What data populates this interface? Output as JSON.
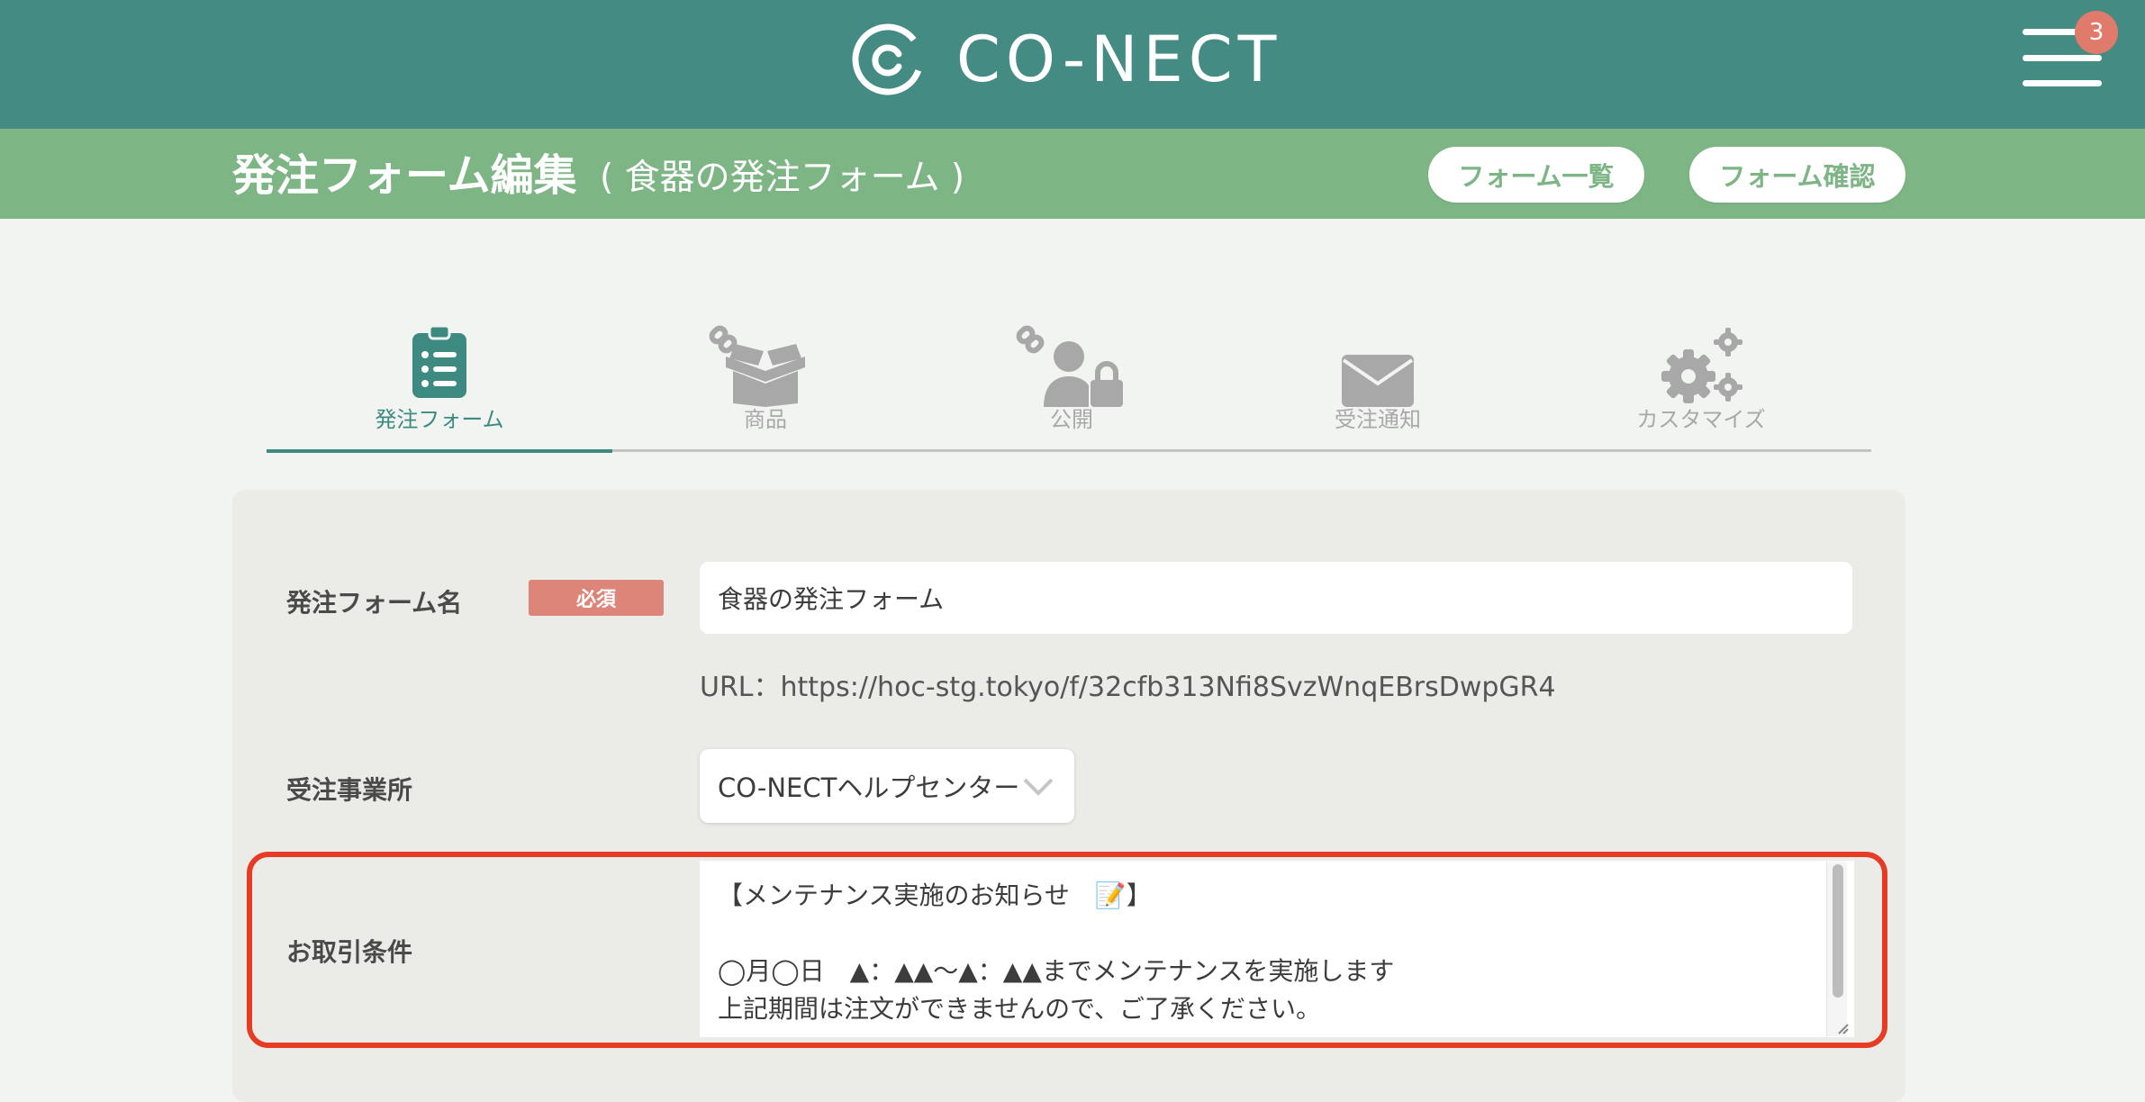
{
  "header": {
    "logo_text": "CO-NECT",
    "notification_count": "3"
  },
  "subheader": {
    "title": "発注フォーム編集",
    "subtitle": "( 食器の発注フォーム )",
    "form_list_button": "フォーム一覧",
    "form_confirm_button": "フォーム確認"
  },
  "tabs": [
    {
      "label": "発注フォーム",
      "icon": "clipboard-list-icon",
      "active": true
    },
    {
      "label": "商品",
      "icon": "box-link-icon",
      "active": false
    },
    {
      "label": "公開",
      "icon": "user-lock-link-icon",
      "active": false
    },
    {
      "label": "受注通知",
      "icon": "envelope-icon",
      "active": false
    },
    {
      "label": "カスタマイズ",
      "icon": "gears-icon",
      "active": false
    }
  ],
  "form": {
    "form_name_label": "発注フォーム名",
    "required_badge": "必須",
    "form_name_value": "食器の発注フォーム",
    "url_text": "URL：https://hoc-stg.tokyo/f/32cfb313Nfi8SvzWnqEBrsDwpGR4",
    "office_label": "受注事業所",
    "office_value": "CO-NECTヘルプセンター",
    "terms_label": "お取引条件",
    "terms_lines": [
      "【メンテナンス実施のお知らせ　📝】",
      "",
      "◯月◯日　▲：▲▲〜▲：▲▲までメンテナンスを実施します",
      "上記期間は注文ができませんので、ご了承ください。"
    ]
  },
  "colors": {
    "header_bg": "#438b83",
    "subheader_bg": "#7db585",
    "accent": "#3c8a80",
    "required": "#dc8578",
    "highlight_border": "#e63c26",
    "badge": "#e07b6c"
  }
}
